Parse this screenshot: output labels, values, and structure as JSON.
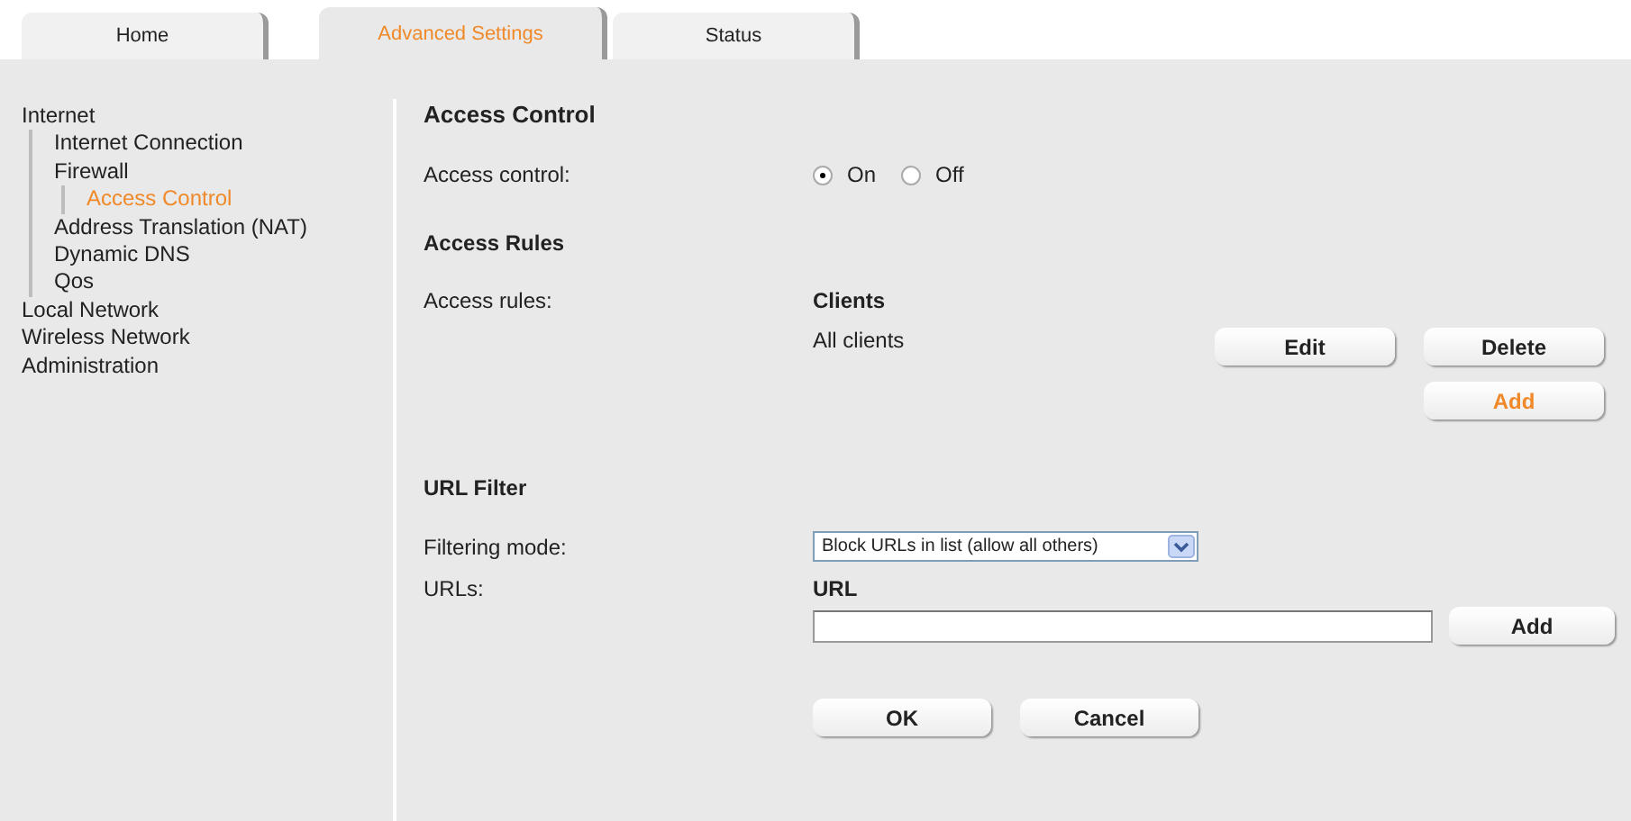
{
  "tabs": [
    {
      "label": "Home",
      "selected": false
    },
    {
      "label": "Advanced Settings",
      "selected": true
    },
    {
      "label": "Status",
      "selected": false
    }
  ],
  "sidebar": {
    "items": [
      {
        "label": "Internet",
        "selected": false,
        "children": [
          {
            "label": "Internet Connection",
            "selected": false
          },
          {
            "label": "Firewall",
            "selected": false,
            "children": [
              {
                "label": "Access Control",
                "selected": true
              }
            ]
          },
          {
            "label": "Address Translation (NAT)",
            "selected": false
          },
          {
            "label": "Dynamic DNS",
            "selected": false
          },
          {
            "label": "Qos",
            "selected": false
          }
        ]
      },
      {
        "label": "Local Network",
        "selected": false
      },
      {
        "label": "Wireless Network",
        "selected": false
      },
      {
        "label": "Administration",
        "selected": false
      }
    ]
  },
  "page_title": "Access Control",
  "access_control": {
    "label": "Access control:",
    "options": [
      {
        "label": "On",
        "selected": true
      },
      {
        "label": "Off",
        "selected": false
      }
    ]
  },
  "access_rules": {
    "heading": "Access Rules",
    "label": "Access rules:",
    "column": "Clients",
    "rows": [
      {
        "clients": "All clients"
      }
    ],
    "buttons": [
      {
        "label": "Edit",
        "highlighted": false
      },
      {
        "label": "Delete",
        "highlighted": false
      },
      {
        "label": "Add",
        "highlighted": true
      }
    ]
  },
  "url_filter": {
    "heading": "URL Filter",
    "mode_label": "Filtering mode:",
    "mode_value": "Block URLs in list (allow all others)",
    "urls_label": "URLs:",
    "column": "URL",
    "add_button": "Add"
  },
  "buttons": [
    "OK",
    "Cancel"
  ]
}
